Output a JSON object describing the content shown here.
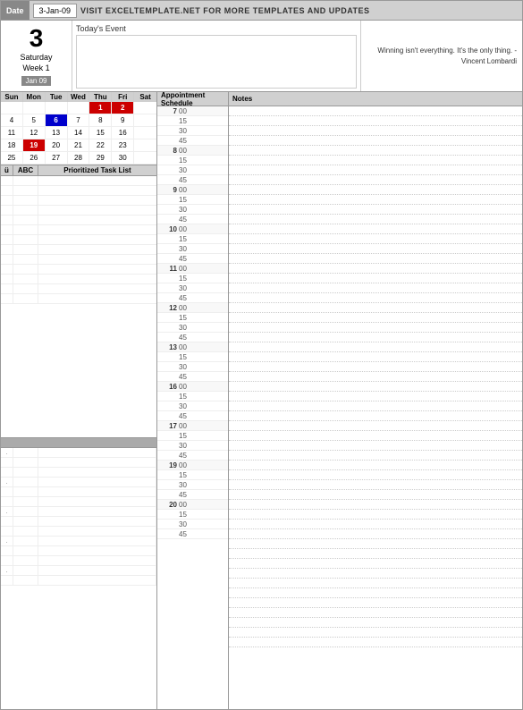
{
  "header": {
    "date_label": "Date",
    "date_value": "3-Jan-09",
    "title": "VISIT EXCELTEMPLATE.NET FOR MORE TEMPLATES AND UPDATES"
  },
  "top": {
    "day_number": "3",
    "day_name": "Saturday",
    "week_label": "Week 1",
    "month_badge": "Jan 09",
    "event_label": "Today's Event",
    "event_text": "",
    "quote": "Winning isn't everything. It's the only thing. - Vincent Lombardi"
  },
  "calendar": {
    "days_header": [
      "Sun",
      "Mon",
      "Tue",
      "Wed",
      "Thu",
      "Fri",
      "Sat"
    ],
    "weeks": [
      [
        {
          "v": "",
          "cls": ""
        },
        {
          "v": "",
          "cls": ""
        },
        {
          "v": "",
          "cls": ""
        },
        {
          "v": "",
          "cls": ""
        },
        {
          "v": "1",
          "cls": "red"
        },
        {
          "v": "2",
          "cls": "red"
        },
        {
          "v": "",
          "cls": ""
        }
      ],
      [
        {
          "v": "4",
          "cls": ""
        },
        {
          "v": "5",
          "cls": ""
        },
        {
          "v": "6",
          "cls": "blue"
        },
        {
          "v": "7",
          "cls": ""
        },
        {
          "v": "8",
          "cls": ""
        },
        {
          "v": "9",
          "cls": ""
        },
        {
          "v": "",
          "cls": ""
        }
      ],
      [
        {
          "v": "11",
          "cls": ""
        },
        {
          "v": "12",
          "cls": ""
        },
        {
          "v": "13",
          "cls": ""
        },
        {
          "v": "14",
          "cls": ""
        },
        {
          "v": "15",
          "cls": ""
        },
        {
          "v": "16",
          "cls": ""
        },
        {
          "v": "",
          "cls": ""
        }
      ],
      [
        {
          "v": "18",
          "cls": ""
        },
        {
          "v": "19",
          "cls": "highlight-red"
        },
        {
          "v": "20",
          "cls": ""
        },
        {
          "v": "21",
          "cls": ""
        },
        {
          "v": "22",
          "cls": ""
        },
        {
          "v": "23",
          "cls": ""
        },
        {
          "v": "",
          "cls": ""
        }
      ],
      [
        {
          "v": "25",
          "cls": ""
        },
        {
          "v": "26",
          "cls": ""
        },
        {
          "v": "27",
          "cls": ""
        },
        {
          "v": "28",
          "cls": ""
        },
        {
          "v": "29",
          "cls": ""
        },
        {
          "v": "30",
          "cls": ""
        },
        {
          "v": "",
          "cls": ""
        }
      ]
    ]
  },
  "task_list": {
    "headers": [
      "ü",
      "ABC",
      "Prioritized Task List"
    ],
    "rows": [
      [
        "",
        "",
        ""
      ],
      [
        "",
        "",
        ""
      ],
      [
        "",
        "",
        ""
      ],
      [
        "",
        "",
        ""
      ],
      [
        "",
        "",
        ""
      ],
      [
        "",
        "",
        ""
      ],
      [
        "",
        "",
        ""
      ],
      [
        "",
        "",
        ""
      ],
      [
        "",
        "",
        ""
      ],
      [
        "",
        "",
        ""
      ],
      [
        "",
        "",
        ""
      ],
      [
        "",
        "",
        ""
      ],
      [
        "",
        "",
        ""
      ]
    ],
    "lower_rows": [
      [
        ".",
        "",
        ""
      ],
      [
        "",
        "",
        ""
      ],
      [
        "",
        "",
        ""
      ],
      [
        ".",
        "",
        ""
      ],
      [
        "",
        "",
        ""
      ],
      [
        "",
        "",
        ""
      ],
      [
        ".",
        "",
        ""
      ],
      [
        "",
        "",
        ""
      ],
      [
        "",
        "",
        ""
      ],
      [
        ".",
        "",
        ""
      ],
      [
        "",
        "",
        ""
      ],
      [
        "",
        "",
        ""
      ],
      [
        ".",
        "",
        ""
      ],
      [
        "",
        "",
        ""
      ]
    ]
  },
  "schedule": {
    "header": "Appointment Schedule",
    "time_blocks": [
      {
        "hour": "7",
        "slots": [
          "00",
          "15",
          "30",
          "45"
        ]
      },
      {
        "hour": "8",
        "slots": [
          "00",
          "15",
          "30",
          "45"
        ]
      },
      {
        "hour": "9",
        "slots": [
          "00",
          "15",
          "30",
          "45"
        ]
      },
      {
        "hour": "10",
        "slots": [
          "00",
          "15",
          "30",
          "45"
        ]
      },
      {
        "hour": "11",
        "slots": [
          "00",
          "15",
          "30",
          "45"
        ]
      },
      {
        "hour": "12",
        "slots": [
          "00",
          "15",
          "30",
          "45"
        ]
      },
      {
        "hour": "13",
        "slots": [
          "00",
          "15",
          "30",
          "45"
        ]
      },
      {
        "hour": "16",
        "slots": [
          "00",
          "15",
          "30",
          "45"
        ]
      },
      {
        "hour": "17",
        "slots": [
          "00",
          "15",
          "30",
          "45"
        ]
      },
      {
        "hour": "19",
        "slots": [
          "00",
          "15",
          "30",
          "45"
        ]
      },
      {
        "hour": "20",
        "slots": [
          "00",
          "15",
          "30",
          "45"
        ]
      }
    ]
  },
  "notes": {
    "header": "Notes",
    "rows": 55
  }
}
